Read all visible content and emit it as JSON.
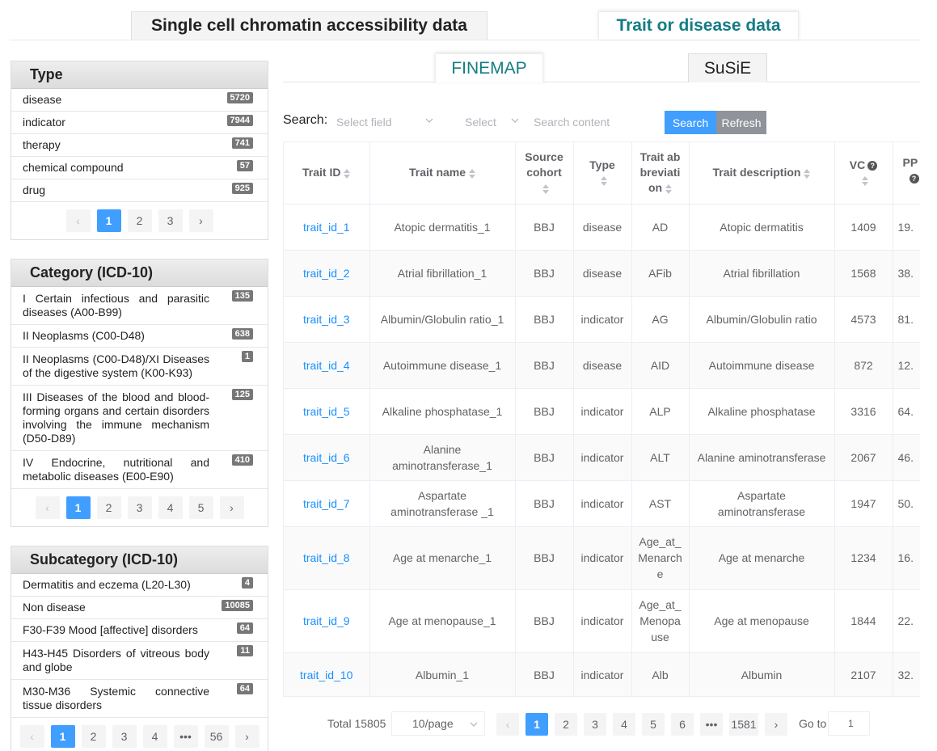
{
  "top_tabs": {
    "inactive": "Single cell chromatin accessibility data",
    "active": "Trait or disease data"
  },
  "type_panel": {
    "title": "Type",
    "items": [
      {
        "label": "disease",
        "count": "5720"
      },
      {
        "label": "indicator",
        "count": "7944"
      },
      {
        "label": "therapy",
        "count": "741"
      },
      {
        "label": "chemical compound",
        "count": "57"
      },
      {
        "label": "drug",
        "count": "925"
      }
    ],
    "pages": [
      "1",
      "2",
      "3"
    ],
    "prev": "‹",
    "next": "›"
  },
  "category_panel": {
    "title": "Category (ICD-10)",
    "items": [
      {
        "label": "I Certain infectious and parasitic diseases (A00-B99)",
        "count": "135"
      },
      {
        "label": "II Neoplasms (C00-D48)",
        "count": "638"
      },
      {
        "label": "II Neoplasms (C00-D48)/XI Diseases of the digestive system (K00-K93)",
        "count": "1"
      },
      {
        "label": "III Diseases of the blood and blood-forming organs and certain disorders involving the immune mechanism (D50-D89)",
        "count": "125"
      },
      {
        "label": "IV Endocrine, nutritional and metabolic diseases (E00-E90)",
        "count": "410"
      }
    ],
    "pages": [
      "1",
      "2",
      "3",
      "4",
      "5"
    ],
    "prev": "‹",
    "next": "›"
  },
  "subcategory_panel": {
    "title": "Subcategory (ICD-10)",
    "items": [
      {
        "label": "Dermatitis and eczema (L20-L30)",
        "count": "4"
      },
      {
        "label": "Non disease",
        "count": "10085"
      },
      {
        "label": "F30-F39 Mood [affective] disorders",
        "count": "64"
      },
      {
        "label": "H43-H45 Disorders of vitreous body and globe",
        "count": "11"
      },
      {
        "label": "M30-M36 Systemic connective tissue disorders",
        "count": "64"
      }
    ],
    "pages": [
      "1",
      "2",
      "3",
      "4",
      "•••",
      "56"
    ],
    "prev": "‹",
    "next": "›"
  },
  "method_tabs": {
    "active": "FINEMAP",
    "inactive": "SuSiE"
  },
  "search": {
    "label": "Search:",
    "field_placeholder": "Select field",
    "select_placeholder": "Select",
    "content_placeholder": "Search content",
    "search_button": "Search",
    "refresh_button": "Refresh"
  },
  "table": {
    "headers": {
      "trait_id": "Trait ID",
      "trait_name": "Trait name",
      "source_cohort": "Source cohort",
      "type": "Type",
      "abbreviation": "Trait ab breviati on",
      "description": "Trait description",
      "vc": "VC",
      "pp": "PP"
    },
    "rows": [
      {
        "id": "trait_id_1",
        "name": "Atopic dermatitis_1",
        "cohort": "BBJ",
        "type": "disease",
        "abbr": "AD",
        "desc": "Atopic dermatitis",
        "vc": "1409",
        "pp": "19."
      },
      {
        "id": "trait_id_2",
        "name": "Atrial fibrillation_1",
        "cohort": "BBJ",
        "type": "disease",
        "abbr": "AFib",
        "desc": "Atrial fibrillation",
        "vc": "1568",
        "pp": "38."
      },
      {
        "id": "trait_id_3",
        "name": "Albumin/Globulin ratio_1",
        "cohort": "BBJ",
        "type": "indicator",
        "abbr": "AG",
        "desc": "Albumin/Globulin ratio",
        "vc": "4573",
        "pp": "81."
      },
      {
        "id": "trait_id_4",
        "name": "Autoimmune disease_1",
        "cohort": "BBJ",
        "type": "disease",
        "abbr": "AID",
        "desc": "Autoimmune disease",
        "vc": "872",
        "pp": "12."
      },
      {
        "id": "trait_id_5",
        "name": "Alkaline phosphatase_1",
        "cohort": "BBJ",
        "type": "indicator",
        "abbr": "ALP",
        "desc": "Alkaline phosphatase",
        "vc": "3316",
        "pp": "64."
      },
      {
        "id": "trait_id_6",
        "name": "Alanine aminotransferase_1",
        "cohort": "BBJ",
        "type": "indicator",
        "abbr": "ALT",
        "desc": "Alanine aminotransferase",
        "vc": "2067",
        "pp": "46."
      },
      {
        "id": "trait_id_7",
        "name": "Aspartate aminotransferase _1",
        "cohort": "BBJ",
        "type": "indicator",
        "abbr": "AST",
        "desc": "Aspartate aminotransferase",
        "vc": "1947",
        "pp": "50."
      },
      {
        "id": "trait_id_8",
        "name": "Age at menarche_1",
        "cohort": "BBJ",
        "type": "indicator",
        "abbr": "Age_at_ Menarch e",
        "desc": "Age at menarche",
        "vc": "1234",
        "pp": "16."
      },
      {
        "id": "trait_id_9",
        "name": "Age at menopause_1",
        "cohort": "BBJ",
        "type": "indicator",
        "abbr": "Age_at_ Menopa use",
        "desc": "Age at menopause",
        "vc": "1844",
        "pp": "22."
      },
      {
        "id": "trait_id_10",
        "name": "Albumin_1",
        "cohort": "BBJ",
        "type": "indicator",
        "abbr": "Alb",
        "desc": "Albumin",
        "vc": "2107",
        "pp": "32."
      }
    ]
  },
  "pagination": {
    "total": "Total 15805",
    "page_size": "10/page",
    "pages": [
      "1",
      "2",
      "3",
      "4",
      "5",
      "6",
      "•••",
      "1581"
    ],
    "prev": "‹",
    "next": "›",
    "goto_label": "Go to",
    "goto_value": "1"
  },
  "colors": {
    "accent": "#409eff",
    "tab_active": "#147c84",
    "link": "#1890ff",
    "refresh": "#909399",
    "badge": "#777777"
  },
  "icons": [
    "sort-caret-icon",
    "help-circle-icon",
    "chevron-down-icon",
    "chevron-left-icon",
    "chevron-right-icon"
  ]
}
